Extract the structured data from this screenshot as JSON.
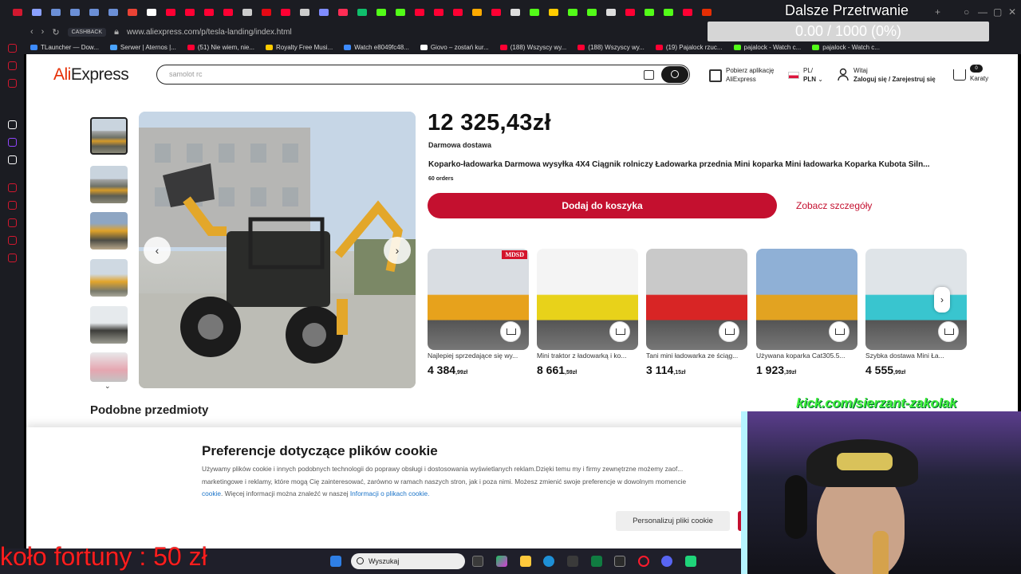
{
  "browser": {
    "url": "www.aliexpress.com/p/tesla-landing/index.html",
    "cashback_label": "CASHBACK",
    "tab_icons": [
      {
        "icon": "opera-icon",
        "color": "#d2182f"
      },
      {
        "icon": "grid-icon",
        "color": "#8aa0ff"
      },
      {
        "icon": "tab-icon",
        "color": "#6b8fd6"
      },
      {
        "icon": "tab-icon",
        "color": "#6b8fd6"
      },
      {
        "icon": "tab-icon",
        "color": "#6b8fd6"
      },
      {
        "icon": "tab-icon",
        "color": "#6b8fd6"
      },
      {
        "icon": "gmail-icon",
        "color": "#ea4335"
      },
      {
        "icon": "chatgpt-icon",
        "color": "#ffffff"
      },
      {
        "icon": "youtube-icon",
        "color": "#ff0033"
      },
      {
        "icon": "youtube-icon",
        "color": "#ff0033"
      },
      {
        "icon": "youtube-icon",
        "color": "#ff0033"
      },
      {
        "icon": "youtube-icon",
        "color": "#ff0033"
      },
      {
        "icon": "openai-icon",
        "color": "#cccccc"
      },
      {
        "icon": "netflix-icon",
        "color": "#e50914"
      },
      {
        "icon": "youtube-icon",
        "color": "#ff0033"
      },
      {
        "icon": "globe-icon",
        "color": "#cccccc"
      },
      {
        "icon": "vercel-icon",
        "color": "#7f8cff"
      },
      {
        "icon": "flag-icon",
        "color": "#ff2d55"
      },
      {
        "icon": "sheet-icon",
        "color": "#0fbf6c"
      },
      {
        "icon": "kick-icon",
        "color": "#53fc18"
      },
      {
        "icon": "kick-icon",
        "color": "#53fc18"
      },
      {
        "icon": "youtube-icon",
        "color": "#ff0033"
      },
      {
        "icon": "youtube-icon",
        "color": "#ff0033"
      },
      {
        "icon": "youtube-icon",
        "color": "#ff0033"
      },
      {
        "icon": "multi-icon",
        "color": "#ffaa00"
      },
      {
        "icon": "youtube-icon",
        "color": "#ff0033"
      },
      {
        "icon": "x-icon",
        "color": "#dddddd"
      },
      {
        "icon": "kick-icon",
        "color": "#53fc18"
      },
      {
        "icon": "pen-icon",
        "color": "#ffcc00"
      },
      {
        "icon": "kick-icon",
        "color": "#53fc18"
      },
      {
        "icon": "kick-icon",
        "color": "#53fc18"
      },
      {
        "icon": "x-icon",
        "color": "#dddddd"
      },
      {
        "icon": "youtube-icon",
        "color": "#ff0033"
      },
      {
        "icon": "kick-icon",
        "color": "#53fc18"
      },
      {
        "icon": "kick-icon",
        "color": "#53fc18"
      },
      {
        "icon": "youtube-icon",
        "color": "#ff0033"
      },
      {
        "icon": "ali-icon",
        "color": "#e62e04"
      }
    ],
    "bookmarks": [
      {
        "label": "TLauncher — Dow...",
        "color": "#3d8bfd"
      },
      {
        "label": "Serwer | Aternos |...",
        "color": "#4aa3ff"
      },
      {
        "label": "(51) Nie wiem, nie...",
        "color": "#ff0033"
      },
      {
        "label": "Royalty Free Musi...",
        "color": "#ffcc00"
      },
      {
        "label": "Watch e8049fc48...",
        "color": "#3d8bfd"
      },
      {
        "label": "Giovo – zostań kur...",
        "color": "#ffffff"
      },
      {
        "label": "(188) Wszyscy wy...",
        "color": "#ff0033"
      },
      {
        "label": "(188) Wszyscy wy...",
        "color": "#ff0033"
      },
      {
        "label": "(19) Pajalock rzuc...",
        "color": "#ff0033"
      },
      {
        "label": "pajalock - Watch c...",
        "color": "#53fc18"
      },
      {
        "label": "pajalock - Watch c...",
        "color": "#53fc18"
      }
    ]
  },
  "header": {
    "logo_ali": "Ali",
    "logo_express": "Express",
    "search_placeholder": "samolot rc",
    "app_line1": "Pobierz aplikację",
    "app_line2": "AliExpress",
    "locale_line1": "PL/",
    "locale_line2": "PLN",
    "account_line1": "Witaj",
    "account_line2": "Zaloguj się / Zarejestruj się",
    "cart_count": "0",
    "cart_label": "Karaty"
  },
  "product": {
    "price": "12 325,43zł",
    "shipping": "Darmowa dostawa",
    "title": "Koparko-ładowarka Darmowa wysyłka 4X4 Ciągnik rolniczy Ładowarka przednia Mini koparka Mini ładowarka Koparka Kubota Siln...",
    "orders": "60 orders",
    "add_to_cart": "Dodaj do koszyka",
    "see_details": "Zobacz szczegóły"
  },
  "recommendations": [
    {
      "name": "Najlepiej sprzedające się wy...",
      "price_main": "4 384",
      "price_cents": ",99zł",
      "badge": "MDSD",
      "bg": "#d9dde2",
      "accent": "#e7a21c"
    },
    {
      "name": "Mini traktor z ładowarką i ko...",
      "price_main": "8 661",
      "price_cents": ",59zł",
      "badge": "",
      "bg": "#f4f4f4",
      "accent": "#e8d21a"
    },
    {
      "name": "Tani mini ładowarka ze ściąg...",
      "price_main": "3 114",
      "price_cents": ",15zł",
      "badge": "",
      "bg": "#c9c9c9",
      "accent": "#d82525"
    },
    {
      "name": "Używana koparka Cat305.5...",
      "price_main": "1 923",
      "price_cents": ",39zł",
      "badge": "",
      "bg": "#8fb0d6",
      "accent": "#e2a321"
    },
    {
      "name": "Szybka dostawa Mini Ła...",
      "price_main": "4 555",
      "price_cents": ",99zł",
      "badge": "",
      "bg": "#dfe4e8",
      "accent": "#39c5cf"
    }
  ],
  "similar_title": "Podobne przedmioty",
  "cookie": {
    "title": "Preferencje dotyczące plików cookie",
    "text1": "Używamy plików cookie i innych podobnych technologii do poprawy obsługi i dostosowania wyświetlanych reklam.Dzięki temu my i firmy zewnętrzne możemy zaof...",
    "text2": "marketingowe i reklamy, które mogą Cię zainteresować, zarówno w ramach naszych stron, jak i poza nimi. Możesz zmienić swoje preferencje w dowolnym momencie",
    "text3_link": "cookie",
    "text3_rest": ". Więcej informacji można znaleźć w naszej ",
    "text3_link2": "Informacji o plikach cookie.",
    "personalize_button": "Personalizuj pliki cookie"
  },
  "overlay": {
    "title": "Dalsze Przetrwanie",
    "progress": "0.00 / 1000 (0%)",
    "progress_fraction": 0.0,
    "kick_url": "kick.com/sierzant-zakolak",
    "wheel": "koło fortuny : 50 zł"
  },
  "taskbar": {
    "search_placeholder": "Wyszukaj"
  }
}
